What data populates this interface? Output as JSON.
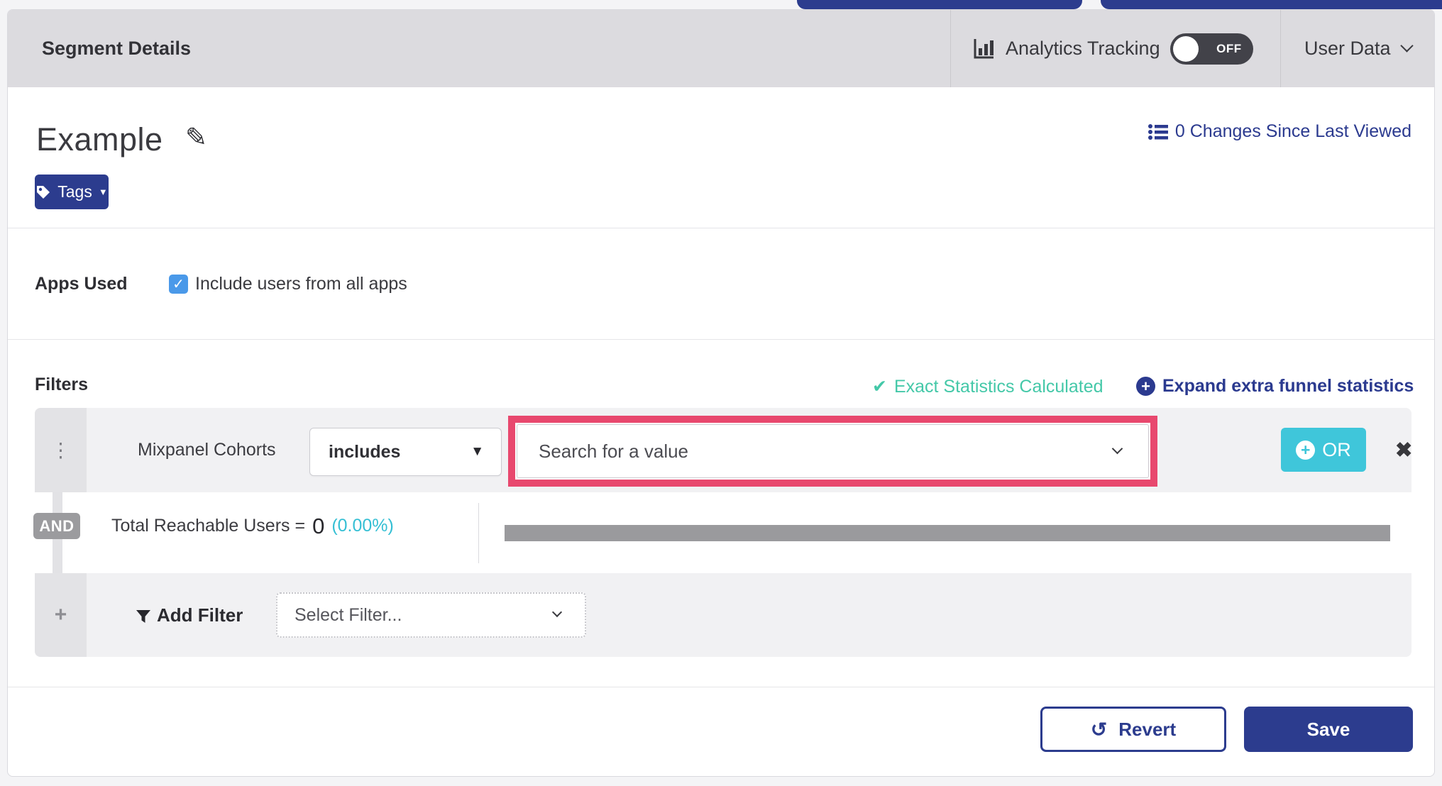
{
  "header": {
    "title": "Segment Details",
    "analytics_tracking_label": "Analytics Tracking",
    "toggle_state": "OFF",
    "user_data_label": "User Data"
  },
  "segment": {
    "name": "Example",
    "changes_link": "0 Changes Since Last Viewed",
    "tags_label": "Tags"
  },
  "apps_used": {
    "label": "Apps Used",
    "checkbox_label": "Include users from all apps",
    "checked": "true"
  },
  "filters": {
    "title": "Filters",
    "exact_stats_label": "Exact Statistics Calculated",
    "expand_stats_label": "Expand extra funnel statistics",
    "filter_row": {
      "name": "Mixpanel Cohorts",
      "operator": "includes",
      "value_placeholder": "Search for a value",
      "or_label": "OR"
    },
    "and_label": "AND",
    "reachable": {
      "label": "Total Reachable Users =",
      "value": "0",
      "percent": "(0.00%)"
    },
    "add_filter": {
      "label": "Add Filter",
      "select_placeholder": "Select Filter..."
    }
  },
  "footer": {
    "revert_label": "Revert",
    "save_label": "Save"
  },
  "icons": {
    "pencil": "✎",
    "check": "✓",
    "check_heavy": "✔",
    "close": "✖",
    "caret_down": "▼",
    "dots": "⋮",
    "plus": "+",
    "undo": "↺"
  },
  "colors": {
    "indigo": "#2c3c8e",
    "cyan": "#3fc6da",
    "teal": "#44c8a8",
    "pink_highlight": "#e8486e",
    "header_gray": "#dcdbdf",
    "row_gray": "#f1f1f3",
    "bar_gray": "#9a9a9d",
    "checkbox_blue": "#4a99e9"
  }
}
